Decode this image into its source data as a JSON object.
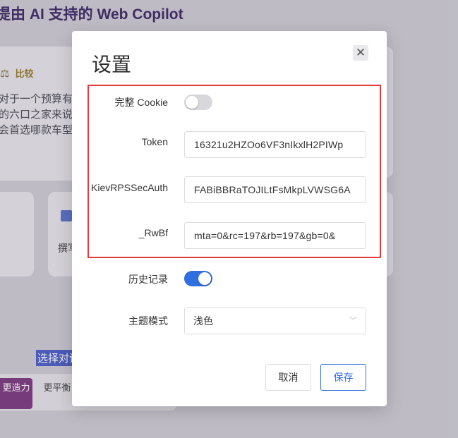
{
  "background": {
    "title": "提由 AI 支持的 Web Copilot",
    "card_compare_label": "比较",
    "card_text": "对于一个预算有限的六口之家来说，会首选哪款车型？",
    "write_label": "撰写",
    "selected_text": "选择对话",
    "pill_1": "更造力",
    "pill_2": "更平衡"
  },
  "dialog": {
    "title": "设置",
    "close_symbol": "✕",
    "fields": {
      "cookie_label": "完整 Cookie",
      "cookie_enabled": false,
      "token_label": "Token",
      "token_value": "16321u2HZOo6VF3nIkxlH2PIWp",
      "kiev_label": "KievRPSSecAuth",
      "kiev_value": "FABiBBRaTOJILtFsMkpLVWSG6A",
      "rwbf_label": "_RwBf",
      "rwbf_value": "mta=0&rc=197&rb=197&gb=0&",
      "history_label": "历史记录",
      "history_enabled": true,
      "theme_label": "主题模式",
      "theme_value": "浅色"
    },
    "cancel_label": "取消",
    "save_label": "保存"
  },
  "colors": {
    "accent": "#2f6fe0",
    "highlight_border": "#e23b3b"
  }
}
